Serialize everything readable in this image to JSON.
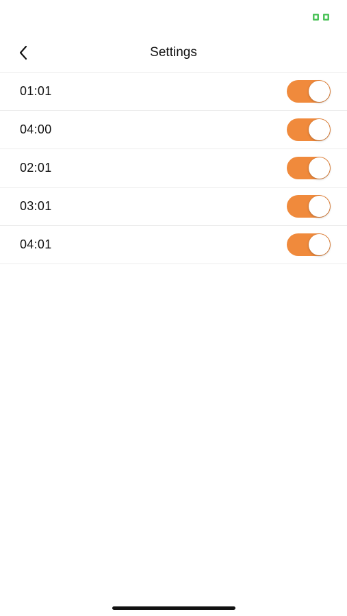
{
  "status_bar": {
    "indicator_icon": "battery-charging-indicator",
    "indicator_color": "#4cc35a"
  },
  "nav": {
    "title": "Settings",
    "back_icon": "chevron-left-icon"
  },
  "accent_color": "#f08a3c",
  "alarms": [
    {
      "time": "01:01",
      "enabled": true
    },
    {
      "time": "04:00",
      "enabled": true
    },
    {
      "time": "02:01",
      "enabled": true
    },
    {
      "time": "03:01",
      "enabled": true
    },
    {
      "time": "04:01",
      "enabled": true
    }
  ]
}
